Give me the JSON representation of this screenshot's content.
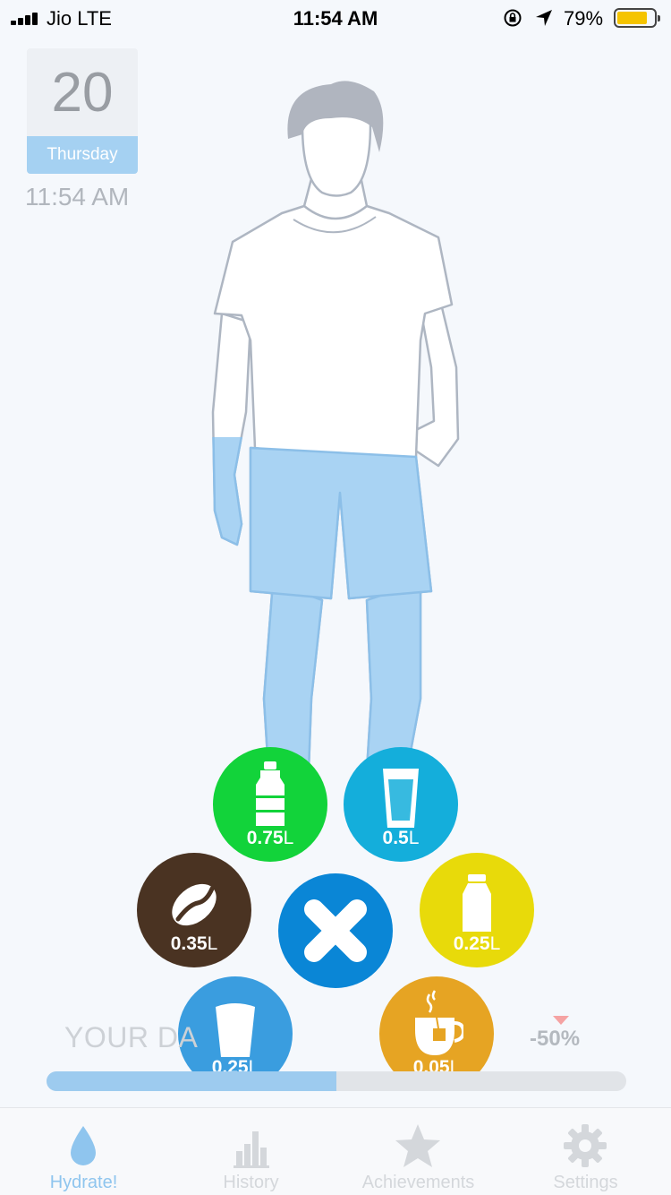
{
  "status_bar": {
    "carrier": "Jio  LTE",
    "time": "11:54 AM",
    "battery_pct": "79%",
    "battery_level": 0.79,
    "icons": [
      "signal-icon",
      "rotation-lock-icon",
      "location-arrow-icon",
      "battery-icon"
    ]
  },
  "date_card": {
    "day": "20",
    "weekday": "Thursday",
    "time": "11:54 AM"
  },
  "drinks": [
    {
      "name": "water-bottle",
      "amount": "0.75",
      "unit": "L",
      "color": "#12d33a",
      "icon": "bottle-icon"
    },
    {
      "name": "water-glass",
      "amount": "0.5",
      "unit": "L",
      "color": "#14aedb",
      "icon": "glass-icon"
    },
    {
      "name": "coffee",
      "amount": "0.35",
      "unit": "L",
      "color": "#4a3322",
      "icon": "coffee-bean-icon"
    },
    {
      "name": "milk",
      "amount": "0.25",
      "unit": "L",
      "color": "#e8da0a",
      "icon": "milk-bottle-icon"
    },
    {
      "name": "cup",
      "amount": "0.25",
      "unit": "L",
      "color": "#3a9ddf",
      "icon": "cup-icon"
    },
    {
      "name": "tea",
      "amount": "0.05",
      "unit": "L",
      "color": "#e6a423",
      "icon": "tea-cup-icon"
    }
  ],
  "close_button": {
    "color": "#0a86d6",
    "icon": "close-icon"
  },
  "daily_goal": {
    "label": "YOUR DA",
    "change": "-50%",
    "progress": 0.5
  },
  "tabs": [
    {
      "label": "Hydrate!",
      "icon": "water-drop-icon",
      "active": true
    },
    {
      "label": "History",
      "icon": "bar-chart-icon",
      "active": false
    },
    {
      "label": "Achievements",
      "icon": "star-icon",
      "active": false
    },
    {
      "label": "Settings",
      "icon": "gear-icon",
      "active": false
    }
  ],
  "colors": {
    "accent": "#8fc5ee",
    "water_fill": "#a9d3f3",
    "background": "#f5f8fc"
  }
}
